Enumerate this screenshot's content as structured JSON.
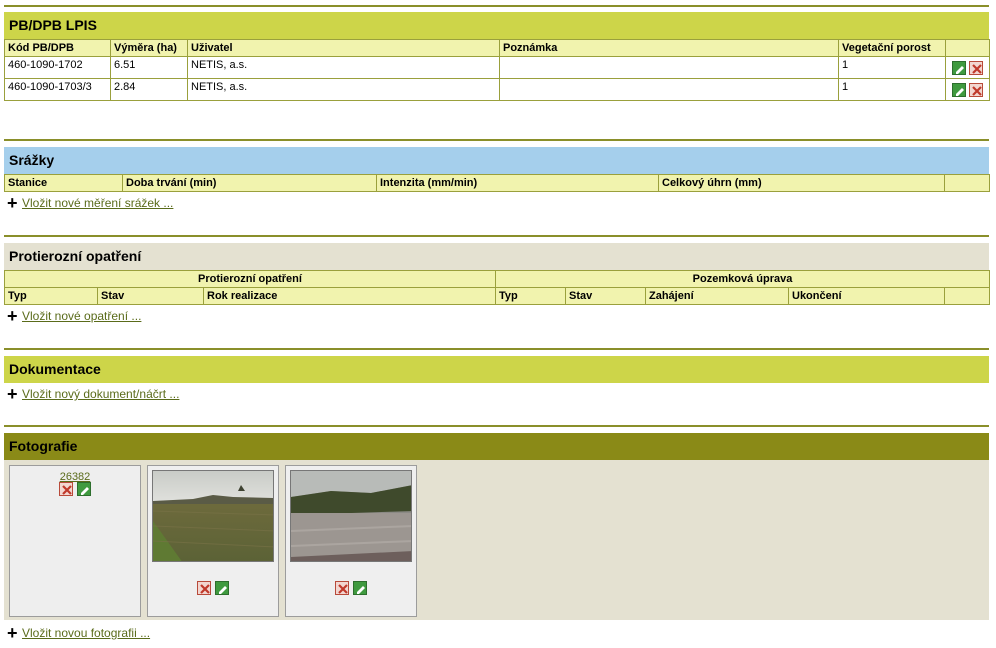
{
  "colors": {
    "olive_header": "#cdd549",
    "table_header": "#f1f3ae",
    "blue_header": "#a5cfec",
    "beige_header": "#e4e1d1",
    "dark_olive_header": "#8a8a17",
    "border": "#9aa03c",
    "link": "#5a6b1a"
  },
  "lpis": {
    "title": "PB/DPB LPIS",
    "columns": [
      "Kód PB/DPB",
      "Výměra (ha)",
      "Uživatel",
      "Poznámka",
      "Vegetační porost",
      ""
    ],
    "rows": [
      {
        "kod": "460-1090-1702",
        "vymera": "6.51",
        "uzivatel": "NETIS, a.s.",
        "poznamka": "",
        "porost": "1"
      },
      {
        "kod": "460-1090-1703/3",
        "vymera": "2.84",
        "uzivatel": "NETIS, a.s.",
        "poznamka": "",
        "porost": "1"
      }
    ]
  },
  "srazky": {
    "title": "Srážky",
    "columns": [
      "Stanice",
      "Doba trvání (min)",
      "Intenzita (mm/min)",
      "Celkový úhrn (mm)",
      ""
    ],
    "add_label": "Vložit nové měření srážek ..."
  },
  "protierozni": {
    "title": "Protierozní opatření",
    "group_left": "Protierozní opatření",
    "group_right": "Pozemková úprava",
    "columns": [
      "Typ",
      "Stav",
      "Rok realizace",
      "Typ",
      "Stav",
      "Zahájení",
      "Ukončení",
      ""
    ],
    "add_label": "Vložit nové opatření ..."
  },
  "dokumentace": {
    "title": "Dokumentace",
    "add_label": "Vložit nový dokument/náčrt ..."
  },
  "fotografie": {
    "title": "Fotografie",
    "first_card_id": "26382",
    "add_label": "Vložit novou fotografii ..."
  }
}
